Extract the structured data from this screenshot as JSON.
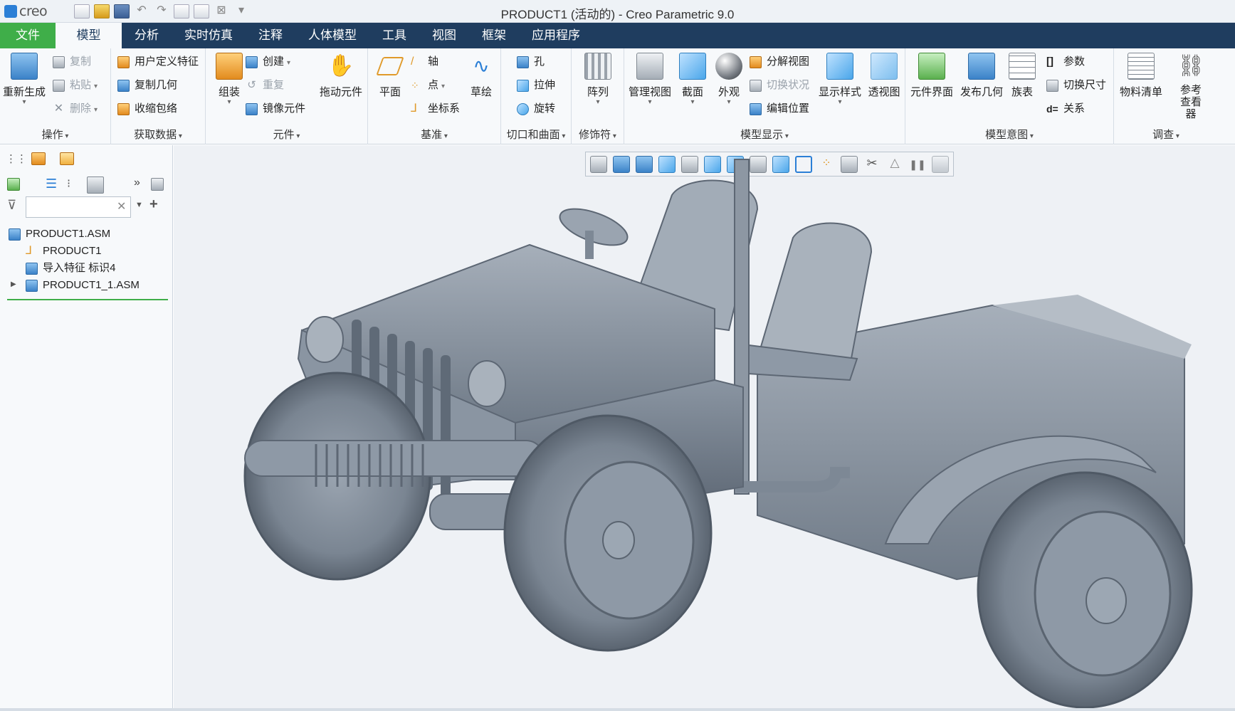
{
  "app": {
    "logo_text": "creo",
    "window_title": "PRODUCT1 (活动的) - Creo Parametric 9.0"
  },
  "menubar": {
    "items": [
      "文件",
      "模型",
      "分析",
      "实时仿真",
      "注释",
      "人体模型",
      "工具",
      "视图",
      "框架",
      "应用程序"
    ],
    "active_index": 1
  },
  "ribbon": {
    "operations": {
      "label": "操作",
      "regenerate": "重新生成",
      "copy": "复制",
      "paste": "粘贴",
      "delete": "删除"
    },
    "get_data": {
      "label": "获取数据",
      "udf": "用户定义特征",
      "copy_geom": "复制几何",
      "shrinkwrap": "收缩包络"
    },
    "component": {
      "label": "元件",
      "assemble": "组装",
      "create": "创建",
      "repeat": "重复",
      "mirror": "镜像元件",
      "drag": "拖动元件"
    },
    "datum": {
      "label": "基准",
      "plane": "平面",
      "axis": "轴",
      "point": "点",
      "csys": "坐标系",
      "sketch": "草绘"
    },
    "cut_surface": {
      "label": "切口和曲面",
      "hole": "孔",
      "extrude": "拉伸",
      "revolve": "旋转"
    },
    "modifiers": {
      "label": "修饰符",
      "pattern": "阵列"
    },
    "model_display": {
      "label": "模型显示",
      "manage_views": "管理视图",
      "section": "截面",
      "appearance": "外观",
      "explode": "分解视图",
      "toggle_status": "切换状况",
      "edit_position": "编辑位置",
      "display_style": "显示样式",
      "perspective": "透视图"
    },
    "model_intent": {
      "label": "模型意图",
      "component_interface": "元件界面",
      "publish_geom": "发布几何",
      "family_table": "族表",
      "parameters": "参数",
      "switch_dims": "切换尺寸",
      "relations": "关系"
    },
    "investigate": {
      "label": "调查",
      "bom": "物料清单",
      "ref_viewer": "参考查看器"
    }
  },
  "model_tree": {
    "search_placeholder": "",
    "items": [
      {
        "label": "PRODUCT1.ASM",
        "level": 0,
        "icon": "assembly-icon"
      },
      {
        "label": "PRODUCT1",
        "level": 1,
        "icon": "csys-icon"
      },
      {
        "label": "导入特征 标识4",
        "level": 1,
        "icon": "import-feature-icon"
      },
      {
        "label": "PRODUCT1_1.ASM",
        "level": 1,
        "icon": "assembly-icon",
        "expandable": true
      }
    ]
  },
  "colors": {
    "menubar": "#1f3d5f",
    "file_tab": "#3fae49",
    "viewport_bg": "#eef1f5",
    "model": "#8e99a6"
  }
}
